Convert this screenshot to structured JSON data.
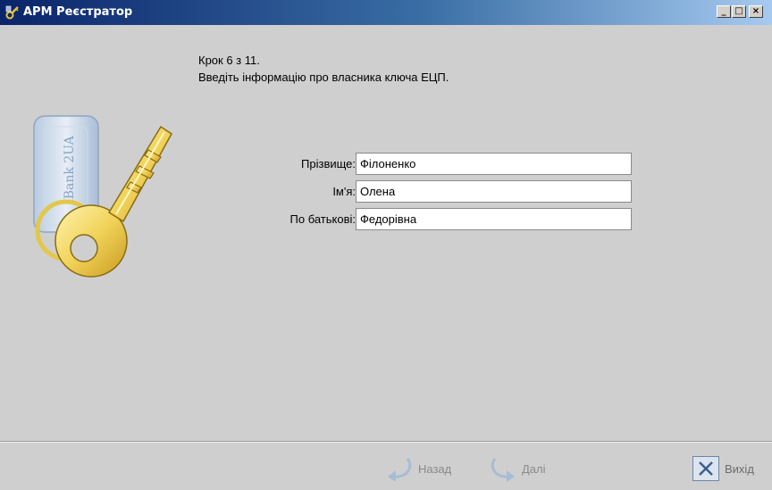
{
  "window": {
    "title": "АРМ Реєстратор",
    "minimize_glyph": "_",
    "maximize_glyph": "□",
    "close_glyph": "×"
  },
  "wizard": {
    "step_line": "Крок 6 з 11.",
    "instruction": "Введіть інформацію про власника ключа ЕЦП."
  },
  "illustration": {
    "token_text": "iBank 2UA",
    "icon": "usb-key-icon"
  },
  "form": {
    "surname_label": "Прізвище:",
    "surname_value": "Філоненко",
    "name_label": "Ім'я:",
    "name_value": "Олена",
    "patronymic_label": "По батькові:",
    "patronymic_value": "Федорівна"
  },
  "buttons": {
    "back_label": "Назад",
    "next_label": "Далі",
    "exit_label": "Вихід"
  },
  "colors": {
    "title_gradient_start": "#0a246a",
    "title_gradient_end": "#a6caf0",
    "window_bg": "#cfcfcf",
    "disabled_text": "#8a8a8a"
  }
}
